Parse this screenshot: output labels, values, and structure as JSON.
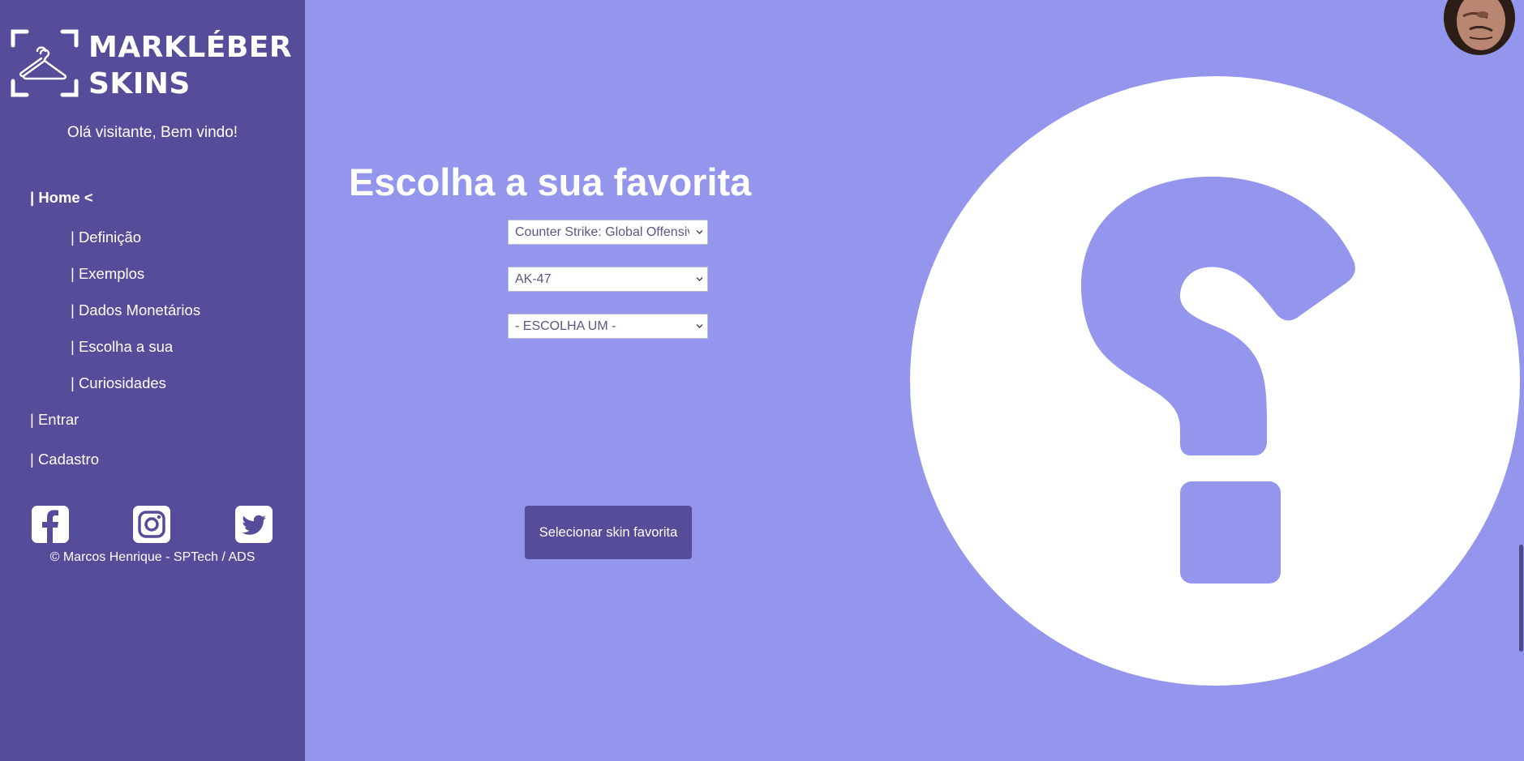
{
  "brand": {
    "line1": "MARKLÉBER",
    "line2": "SKINS",
    "logo_icon": "hanger-icon"
  },
  "sidebar": {
    "welcome": "Olá visitante, Bem vindo!",
    "nav": [
      {
        "label": "| Home <",
        "active": true
      },
      {
        "label": "| Definição"
      },
      {
        "label": "| Exemplos"
      },
      {
        "label": "| Dados Monetários"
      },
      {
        "label": "| Escolha a sua"
      },
      {
        "label": "| Curiosidades"
      },
      {
        "label": "| Entrar"
      },
      {
        "label": "| Cadastro"
      }
    ],
    "social": [
      "facebook-icon",
      "instagram-icon",
      "twitter-icon"
    ],
    "footer": "© Marcos Henrique - SPTech / ADS"
  },
  "main": {
    "title": "Escolha a sua favorita",
    "selects": [
      {
        "value": "Counter Strike: Global Offensive"
      },
      {
        "value": "AK-47"
      },
      {
        "value": "- ESCOLHA UM -"
      }
    ],
    "button_label": "Selecionar skin favorita",
    "illustration": "question-mark-icon"
  },
  "colors": {
    "sidebar_bg": "#554c9a",
    "page_bg": "#9396ec",
    "button_bg": "#554c9a",
    "text_light": "#ffffff"
  }
}
